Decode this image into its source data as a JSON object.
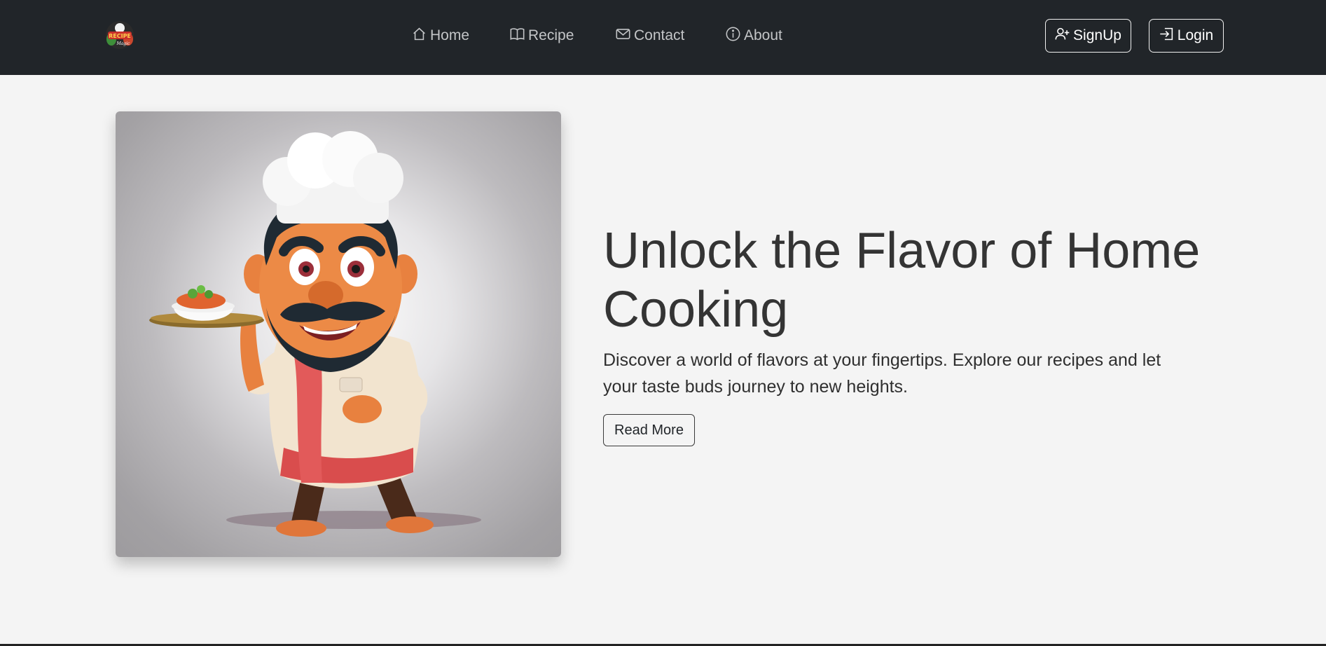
{
  "header": {
    "logo_alt": "Recipe Magic",
    "nav": [
      {
        "label": "Home",
        "icon": "house-icon"
      },
      {
        "label": "Recipe",
        "icon": "book-icon"
      },
      {
        "label": "Contact",
        "icon": "envelope-icon"
      },
      {
        "label": "About",
        "icon": "info-circle-icon"
      }
    ],
    "signup_label": "SignUp",
    "login_label": "Login"
  },
  "hero": {
    "image_alt": "Cartoon chef holding a plate of food",
    "title": "Unlock the Flavor of Home Cooking",
    "description": "Discover a world of flavors at your fingertips. Explore our recipes and let your taste buds journey to new heights.",
    "read_more_label": "Read More"
  },
  "colors": {
    "navbar_bg": "#212529",
    "page_bg": "#f4f4f4",
    "nav_link": "#c3c5c7",
    "text_dark": "#343434"
  }
}
